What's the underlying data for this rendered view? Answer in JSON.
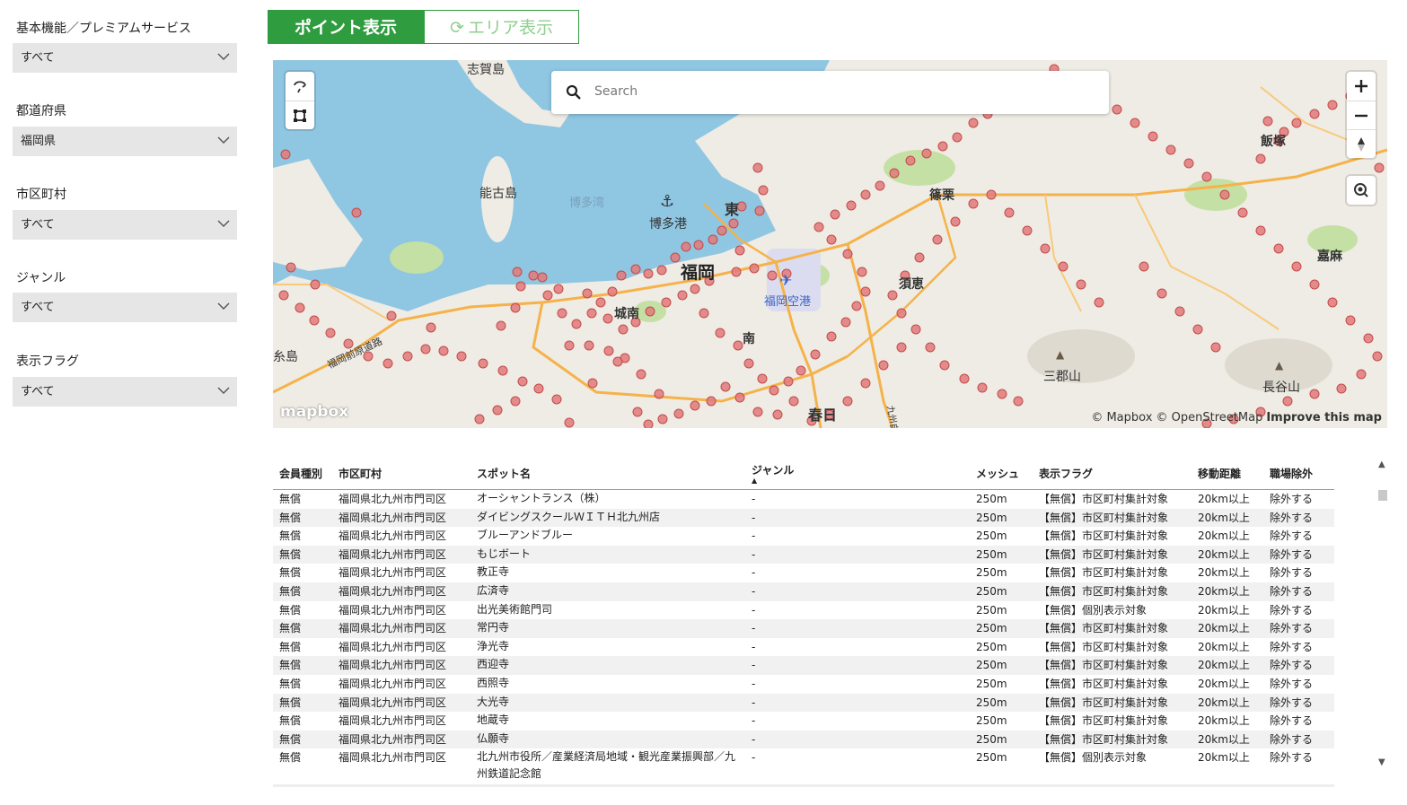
{
  "filters": [
    {
      "label": "基本機能／プレミアムサービス",
      "value": "すべて"
    },
    {
      "label": "都道府県",
      "value": "福岡県"
    },
    {
      "label": "市区町村",
      "value": "すべて"
    },
    {
      "label": "ジャンル",
      "value": "すべて"
    },
    {
      "label": "表示フラグ",
      "value": "すべて"
    }
  ],
  "tabs": {
    "point": "ポイント表示",
    "area": "エリア表示",
    "active": "point"
  },
  "map": {
    "search_placeholder": "Search",
    "labels": {
      "shikanoshima": "志賀島",
      "nokonoshima": "能古島",
      "hakatawan": "博多湾",
      "hakatako": "博多港",
      "higashi": "東",
      "fukuoka": "福岡",
      "jonan": "城南",
      "minami": "南",
      "fukuoka_airport": "福岡空港",
      "sue": "須恵",
      "kasuya": "篠栗",
      "iizuka": "飯塚",
      "kaho": "嘉麻",
      "sangunzan": "三郡山",
      "nagatani": "長谷山",
      "kasuga": "春日",
      "itoshima": "糸島",
      "fukuoka_maebaru_road": "福岡前原道路",
      "kyushu_expressway": "九州自"
    },
    "attribution": "© Mapbox © OpenStreetMap",
    "improve": "Improve this map",
    "logo": "mapbox",
    "colors": {
      "water": "#8fc6e2",
      "land": "#eeece4",
      "park": "#c5e0a5",
      "road": "#f6b24a",
      "marker": "#e07a7a",
      "marker_stroke": "#c44b4b"
    }
  },
  "table": {
    "headers": [
      "会員種別",
      "市区町村",
      "スポット名",
      "ジャンル",
      "メッシュ",
      "表示フラグ",
      "移動距離",
      "職場除外"
    ],
    "sort_column": "ジャンル",
    "rows": [
      [
        "無償",
        "福岡県北九州市門司区",
        "オーシャントランス（株）",
        "-",
        "250m",
        "【無償】市区町村集計対象",
        "20km以上",
        "除外する"
      ],
      [
        "無償",
        "福岡県北九州市門司区",
        "ダイビングスクールＷＩＴＨ北九州店",
        "-",
        "250m",
        "【無償】市区町村集計対象",
        "20km以上",
        "除外する"
      ],
      [
        "無償",
        "福岡県北九州市門司区",
        "ブルーアンドブルー",
        "-",
        "250m",
        "【無償】市区町村集計対象",
        "20km以上",
        "除外する"
      ],
      [
        "無償",
        "福岡県北九州市門司区",
        "もじボート",
        "-",
        "250m",
        "【無償】市区町村集計対象",
        "20km以上",
        "除外する"
      ],
      [
        "無償",
        "福岡県北九州市門司区",
        "教正寺",
        "-",
        "250m",
        "【無償】市区町村集計対象",
        "20km以上",
        "除外する"
      ],
      [
        "無償",
        "福岡県北九州市門司区",
        "広済寺",
        "-",
        "250m",
        "【無償】市区町村集計対象",
        "20km以上",
        "除外する"
      ],
      [
        "無償",
        "福岡県北九州市門司区",
        "出光美術館門司",
        "-",
        "250m",
        "【無償】個別表示対象",
        "20km以上",
        "除外する"
      ],
      [
        "無償",
        "福岡県北九州市門司区",
        "常円寺",
        "-",
        "250m",
        "【無償】市区町村集計対象",
        "20km以上",
        "除外する"
      ],
      [
        "無償",
        "福岡県北九州市門司区",
        "浄光寺",
        "-",
        "250m",
        "【無償】市区町村集計対象",
        "20km以上",
        "除外する"
      ],
      [
        "無償",
        "福岡県北九州市門司区",
        "西迎寺",
        "-",
        "250m",
        "【無償】市区町村集計対象",
        "20km以上",
        "除外する"
      ],
      [
        "無償",
        "福岡県北九州市門司区",
        "西照寺",
        "-",
        "250m",
        "【無償】市区町村集計対象",
        "20km以上",
        "除外する"
      ],
      [
        "無償",
        "福岡県北九州市門司区",
        "大光寺",
        "-",
        "250m",
        "【無償】市区町村集計対象",
        "20km以上",
        "除外する"
      ],
      [
        "無償",
        "福岡県北九州市門司区",
        "地蔵寺",
        "-",
        "250m",
        "【無償】市区町村集計対象",
        "20km以上",
        "除外する"
      ],
      [
        "無償",
        "福岡県北九州市門司区",
        "仏願寺",
        "-",
        "250m",
        "【無償】市区町村集計対象",
        "20km以上",
        "除外する"
      ],
      [
        "無償",
        "福岡県北九州市門司区",
        "北九州市役所／産業経済局地域・観光産業振興部／九州鉄道記念館",
        "-",
        "250m",
        "【無償】個別表示対象",
        "20km以上",
        "除外する"
      ]
    ]
  }
}
